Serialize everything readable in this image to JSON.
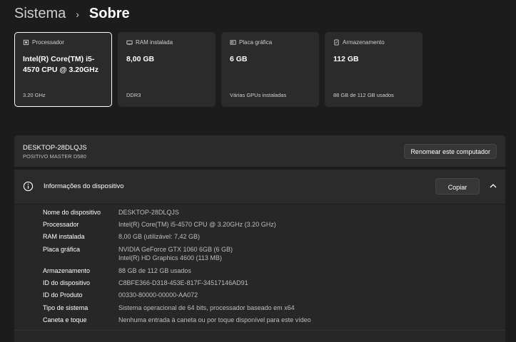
{
  "breadcrumb": {
    "parent": "Sistema",
    "separator": "›",
    "current": "Sobre"
  },
  "cards": [
    {
      "title": "Processador",
      "value": "Intel(R) Core(TM) i5-4570 CPU @ 3.20GHz",
      "foot": "3.20 GHz",
      "icon": "processor-icon"
    },
    {
      "title": "RAM instalada",
      "value": "8,00 GB",
      "foot": "DDR3",
      "icon": "ram-icon"
    },
    {
      "title": "Placa gráfica",
      "value": "6 GB",
      "foot": "Várias GPUs instaladas",
      "icon": "gpu-icon"
    },
    {
      "title": "Armazenamento",
      "value": "112 GB",
      "foot": "88 GB de 112 GB usados",
      "icon": "storage-icon"
    }
  ],
  "computer": {
    "name": "DESKTOP-28DLQJS",
    "model": "POSITIVO MASTER D580",
    "rename_label": "Renomear este computador"
  },
  "device_info": {
    "title": "Informações do dispositivo",
    "copy_label": "Copiar",
    "rows": [
      {
        "label": "Nome do dispositivo",
        "value": "DESKTOP-28DLQJS"
      },
      {
        "label": "Processador",
        "value": "Intel(R) Core(TM) i5-4570 CPU @ 3.20GHz (3.20 GHz)"
      },
      {
        "label": "RAM instalada",
        "value": "8,00 GB (utilizável: 7,42 GB)"
      },
      {
        "label": "Placa gráfica",
        "value": "NVIDIA GeForce GTX 1060 6GB (6 GB)",
        "value2": "Intel(R) HD Graphics 4600 (113 MB)"
      },
      {
        "label": "Armazenamento",
        "value": "88 GB de 112 GB usados"
      },
      {
        "label": "ID do dispositivo",
        "value": "C8BFE366-D318-453E-817F-34517146AD91"
      },
      {
        "label": "ID do Produto",
        "value": "00330-80000-00000-AA072"
      },
      {
        "label": "Tipo de sistema",
        "value": "Sistema operacional de 64 bits, processador baseado em x64"
      },
      {
        "label": "Caneta e toque",
        "value": "Nenhuma entrada à caneta ou por toque disponível para este vídeo"
      }
    ]
  }
}
